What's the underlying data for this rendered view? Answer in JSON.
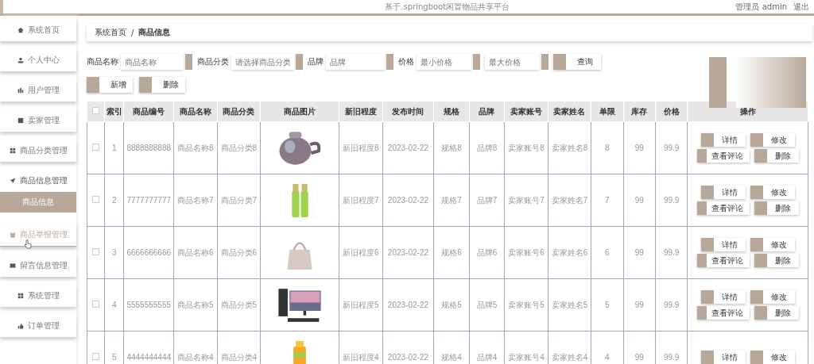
{
  "header": {
    "title": "基于.springboot闲置物品共享平台",
    "user": "管理员 admin",
    "logout": "退出"
  },
  "sidebar": {
    "items": [
      {
        "label": "系统首页",
        "hovered": false
      },
      {
        "label": "个人中心",
        "hovered": false
      },
      {
        "label": "用户管理",
        "hovered": false
      },
      {
        "label": "卖家管理",
        "hovered": false
      },
      {
        "label": "商品分类管理",
        "hovered": false
      },
      {
        "label": "商品信息管理",
        "hovered": false,
        "expanded": true,
        "children": [
          {
            "label": "商品信息",
            "selected": true
          }
        ]
      },
      {
        "label": "商品举报管理",
        "hovered": true
      },
      {
        "label": "留言信息管理",
        "hovered": false
      },
      {
        "label": "系统管理",
        "hovered": false
      },
      {
        "label": "订单管理",
        "hovered": false
      }
    ]
  },
  "breadcrumb": [
    "系统首页",
    "/",
    "商品信息"
  ],
  "search": {
    "fields": [
      {
        "label": "商品名称",
        "placeholder": "商品名称"
      },
      {
        "label": "商品分类",
        "placeholder": "请选择商品分类"
      },
      {
        "label": "品牌",
        "placeholder": "品牌"
      },
      {
        "label": "价格",
        "placeholder": "最小价格"
      },
      {
        "placeholder": "最大价格"
      }
    ],
    "button": "查询"
  },
  "actions": [
    "新增",
    "删除"
  ],
  "table": {
    "header_checked": false,
    "columns": [
      "索引",
      "商品编号",
      "商品名称",
      "商品分类",
      "商品图片",
      "新旧程度",
      "发布时间",
      "规格",
      "品牌",
      "卖家账号",
      "卖家姓名",
      "单限",
      "库存",
      "价格",
      "操作"
    ],
    "rows": [
      {
        "checked": false,
        "cells": [
          "1",
          "8888888888",
          "商品名称8",
          "商品分类8",
          "",
          "新旧程度8",
          "2023-02-22",
          "规格8",
          "品牌8",
          "卖家账号8",
          "卖家姓名8",
          "8",
          "99",
          "99.9"
        ],
        "buttons": [
          "详情",
          "修改",
          "查看评论",
          "删除"
        ]
      },
      {
        "checked": false,
        "cells": [
          "2",
          "7777777777",
          "商品名称7",
          "商品分类7",
          "",
          "新旧程度7",
          "2023-02-22",
          "规格7",
          "品牌7",
          "卖家账号7",
          "卖家姓名7",
          "7",
          "99",
          "99.9"
        ],
        "buttons": [
          "详情",
          "修改",
          "查看评论",
          "删除"
        ]
      },
      {
        "checked": false,
        "cells": [
          "3",
          "6666666666",
          "商品名称6",
          "商品分类6",
          "",
          "新旧程度6",
          "2023-02-22",
          "规格6",
          "品牌6",
          "卖家账号6",
          "卖家姓名6",
          "6",
          "99",
          "99.9"
        ],
        "buttons": [
          "详情",
          "修改",
          "查看评论",
          "删除"
        ]
      },
      {
        "checked": false,
        "cells": [
          "4",
          "5555555555",
          "商品名称5",
          "商品分类5",
          "",
          "新旧程度5",
          "2023-02-22",
          "规格5",
          "品牌5",
          "卖家账号5",
          "卖家姓名5",
          "5",
          "99",
          "99.9"
        ],
        "buttons": [
          "详情",
          "修改",
          "查看评论",
          "删除"
        ]
      },
      {
        "checked": false,
        "cells": [
          "5",
          "4444444444",
          "商品名称4",
          "商品分类4",
          "",
          "新旧程度4",
          "2023-02-22",
          "规格4",
          "品牌4",
          "卖家账号4",
          "卖家姓名4",
          "4",
          "99",
          "99.9"
        ],
        "buttons": [
          "详情",
          "修改"
        ]
      }
    ]
  }
}
